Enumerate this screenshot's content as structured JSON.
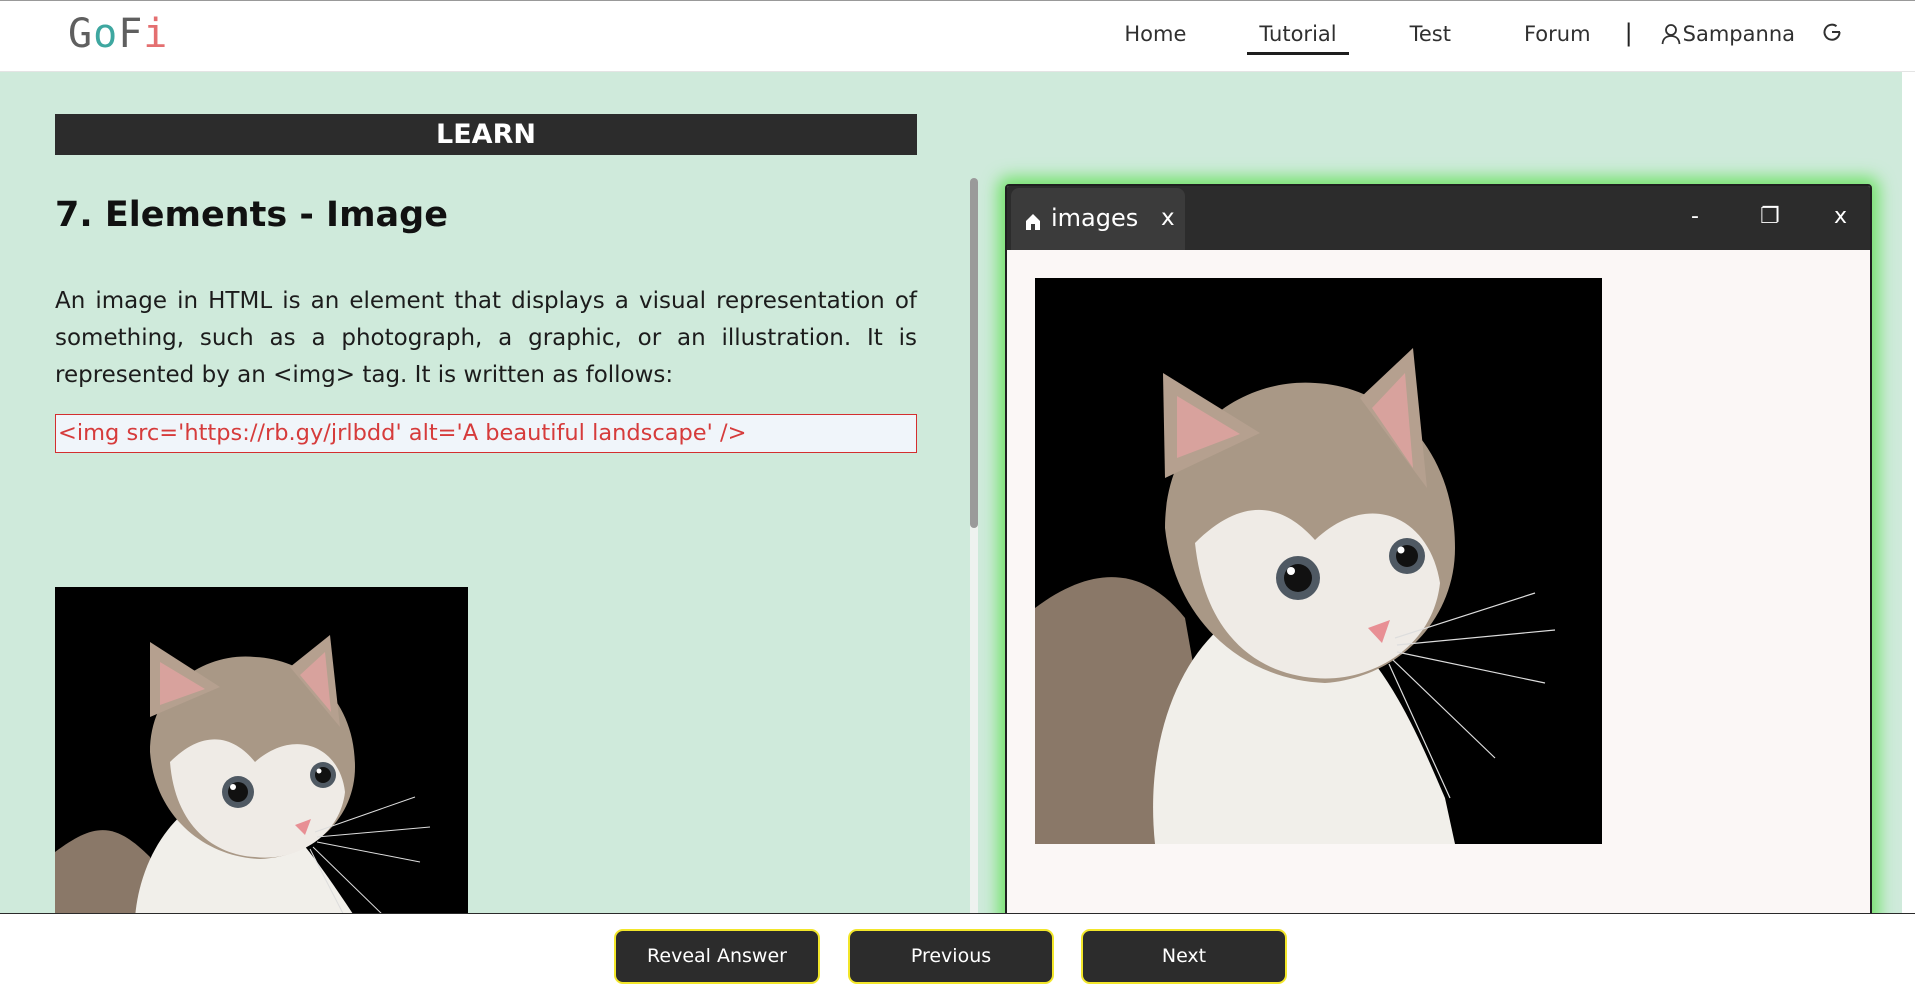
{
  "header": {
    "logo": {
      "g": "G",
      "o": "o",
      "f": "F",
      "i": "i"
    },
    "nav": [
      {
        "label": "Home",
        "active": false
      },
      {
        "label": "Tutorial",
        "active": true
      },
      {
        "label": "Test",
        "active": false
      },
      {
        "label": "Forum",
        "active": false
      }
    ],
    "separator": "|",
    "user": "Sampanna"
  },
  "lesson": {
    "banner": "LEARN",
    "title": "7. Elements - Image",
    "paragraph": "An image in HTML is an element that displays a visual representation of something, such as a photograph, a graphic, or an illustration. It is represented by an <img> tag. It is written as follows:",
    "code": "<img src='https://rb.gy/jrlbdd' alt='A beautiful landscape' />"
  },
  "window": {
    "tab_label": "images",
    "tab_close": "x",
    "minimize": "-",
    "maximize": "❐",
    "close": "x"
  },
  "footer": {
    "reveal": "Reveal Answer",
    "previous": "Previous",
    "next": "Next"
  },
  "colors": {
    "accent_green": "#74e36c",
    "button_border": "#f2e62a",
    "code_red": "#d63b3b",
    "main_bg": "#cfeadb"
  }
}
